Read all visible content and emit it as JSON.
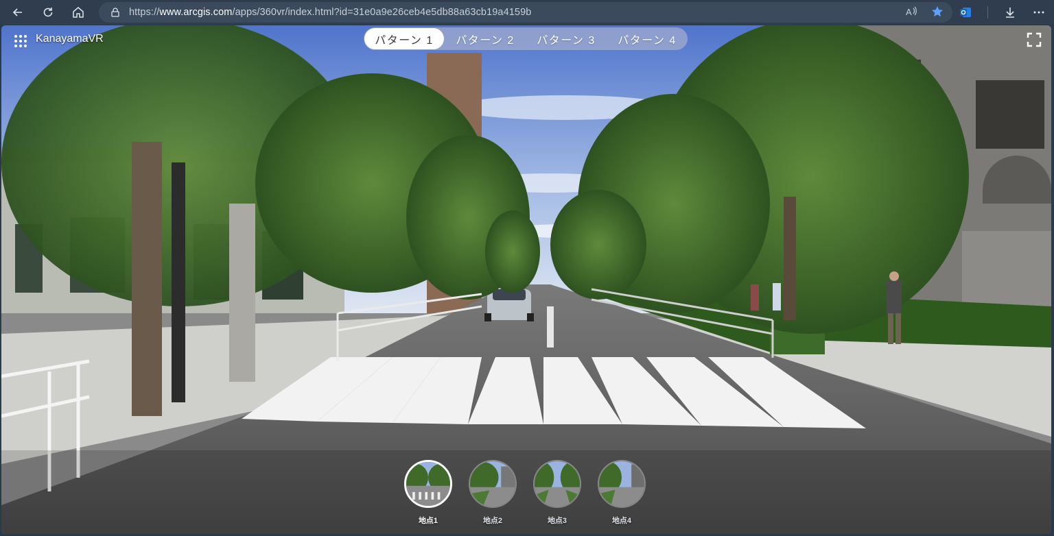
{
  "browser": {
    "url_prefix": "https://",
    "url_host": "www.arcgis.com",
    "url_path": "/apps/360vr/index.html?id=31e0a9e26ceb4e5db88a63cb19a4159b",
    "icons": [
      "back-icon",
      "refresh-icon",
      "home-icon",
      "lock-icon",
      "read-aloud-icon",
      "favorite-star-icon",
      "outlook-icon",
      "download-icon",
      "more-icon"
    ]
  },
  "app": {
    "title": "KanayamaVR",
    "patterns": [
      {
        "label": "パターン 1",
        "active": true
      },
      {
        "label": "パターン 2",
        "active": false
      },
      {
        "label": "パターン 3",
        "active": false
      },
      {
        "label": "パターン 4",
        "active": false
      }
    ],
    "locations": [
      {
        "label": "地点1",
        "active": true
      },
      {
        "label": "地点2",
        "active": false
      },
      {
        "label": "地点3",
        "active": false
      },
      {
        "label": "地点4",
        "active": false
      }
    ]
  },
  "colors": {
    "chrome": "#2f3d4e",
    "sky": "#5f86d6",
    "foliage": "#3f6a2a",
    "road": "#6a6a6a",
    "hedge": "#2f5a1e"
  }
}
